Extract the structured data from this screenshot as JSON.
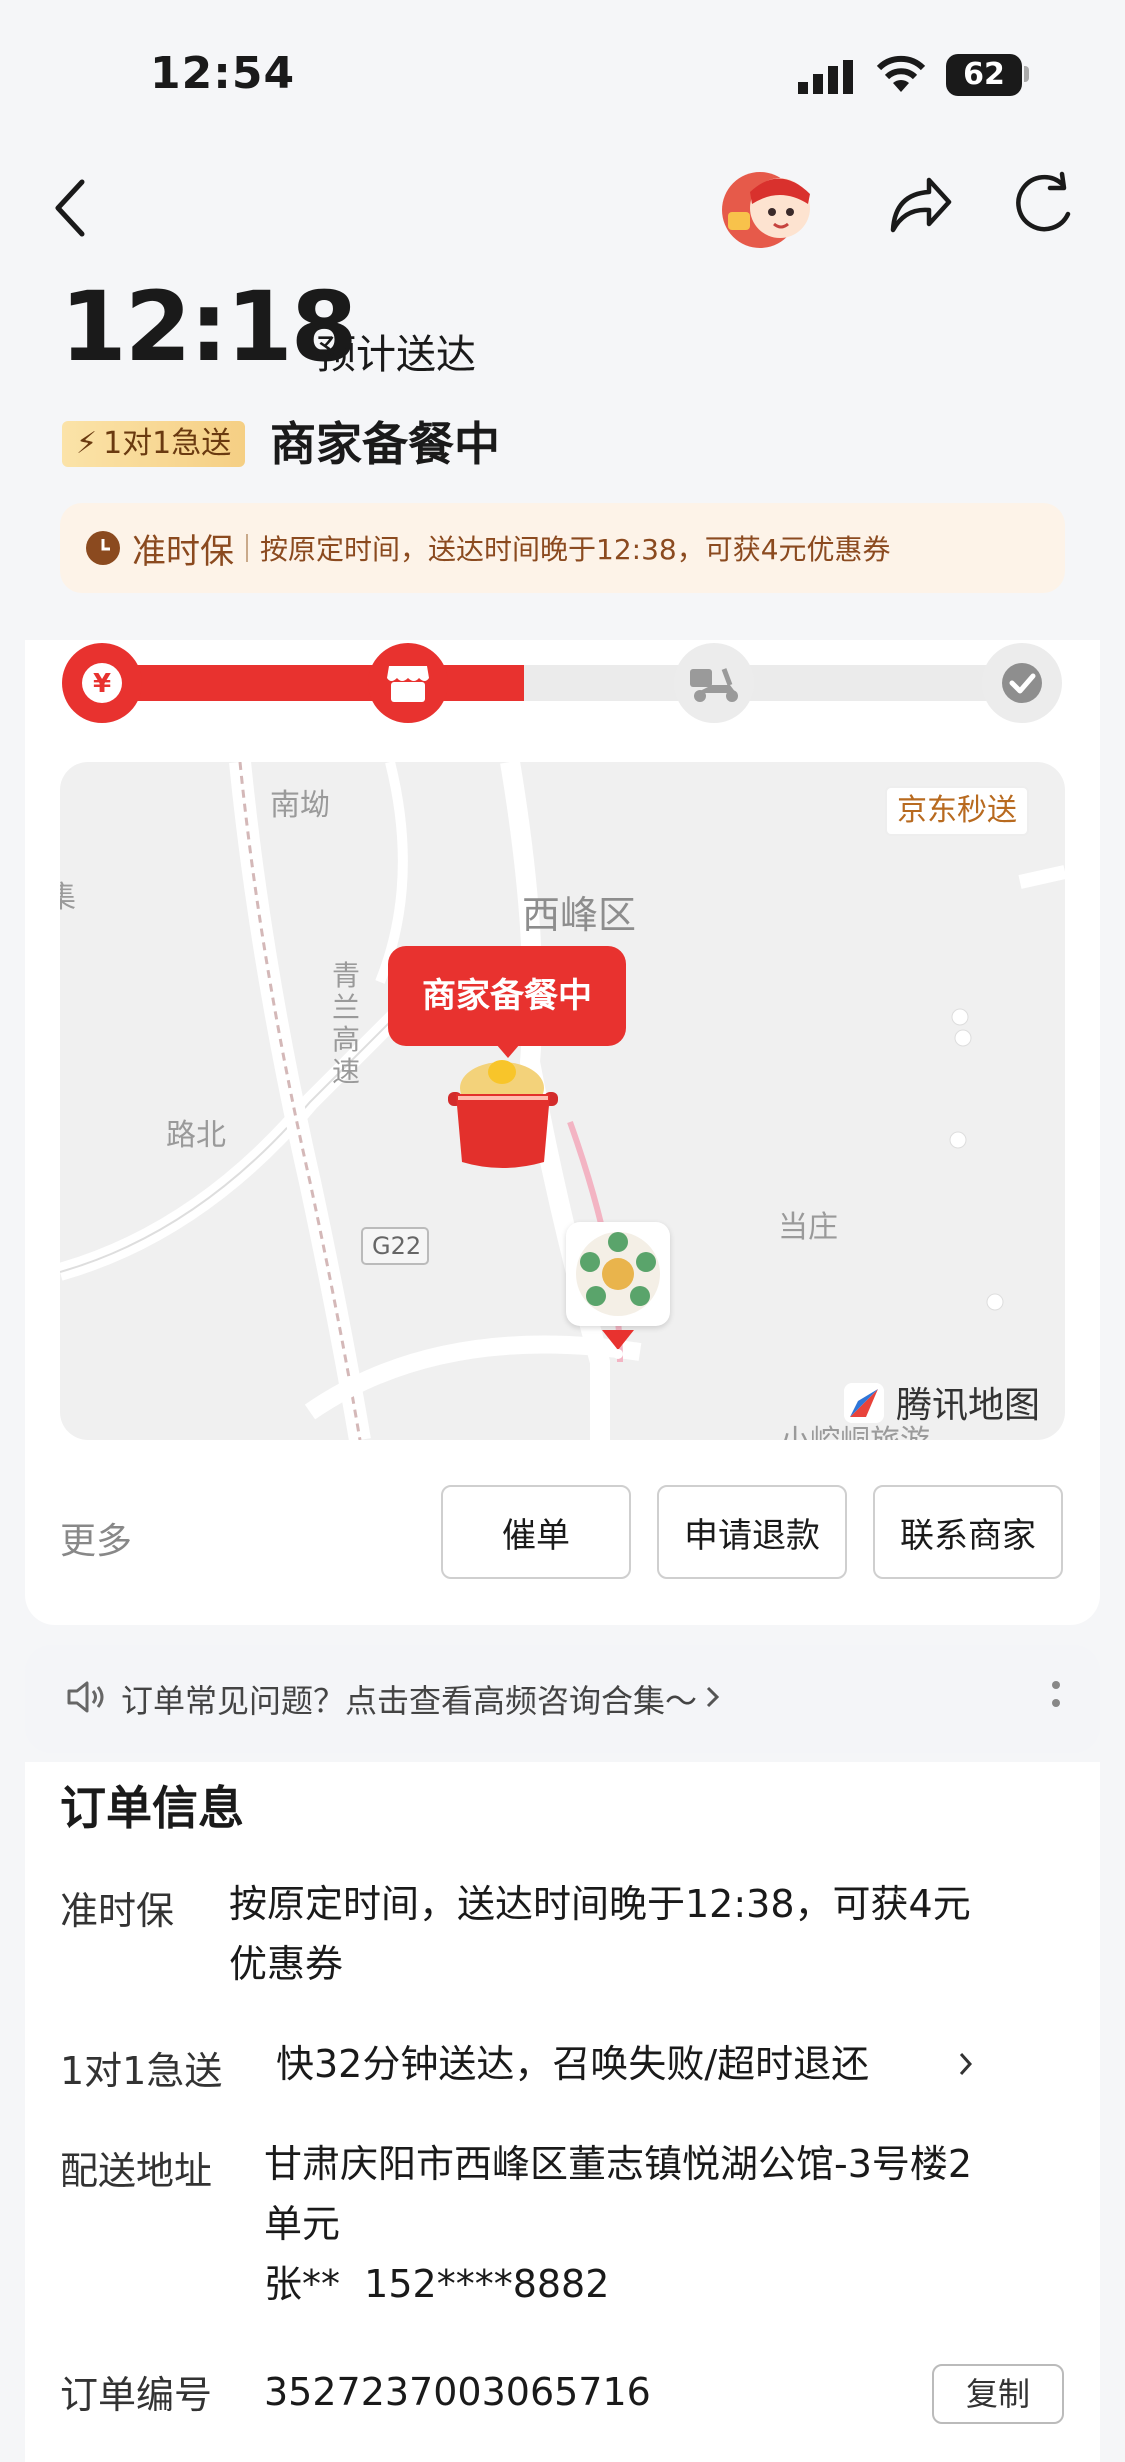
{
  "status_bar": {
    "time": "12:54",
    "battery": "62"
  },
  "header": {
    "eta_time": "12:18",
    "eta_label": "预计送达"
  },
  "express_badge": "1对1急送",
  "order_status": "商家备餐中",
  "ontime": {
    "title": "准时保",
    "desc": "按原定时间，送达时间晚于12:38，可获4元优惠券"
  },
  "progress": {
    "current_step": 2,
    "total_steps": 4,
    "steps": [
      "yen-icon",
      "store-icon",
      "scooter-icon",
      "check-icon"
    ],
    "accent": "#e8322f"
  },
  "map": {
    "provider": "京东秒送",
    "bubble": "商家备餐中",
    "labels": {
      "nanao": "南坳",
      "xifeng": "西峰区",
      "lubei": "路北",
      "dangzhuang": "当庄",
      "highway": "青兰高速",
      "road_code": "G22",
      "edge": "集",
      "bottom": "小崆峒旅游"
    },
    "attribution": "腾讯地图"
  },
  "actions": {
    "more": "更多",
    "urge": "催单",
    "refund": "申请退款",
    "contact": "联系商家"
  },
  "faq": "订单常见问题？点击查看高频咨询合集～",
  "order_info": {
    "title": "订单信息",
    "ontime_label": "准时保",
    "ontime_value_1": "按原定时间，送达时间晚于12:38，可获4元",
    "ontime_value_2": "优惠券",
    "express_label": "1对1急送",
    "express_value": "快32分钟送达，召唤失败/超时退还",
    "address_label": "配送地址",
    "address_1": "甘肃庆阳市西峰区董志镇悦湖公馆-3号楼2",
    "address_2": "单元",
    "contact": "张**  152****8882",
    "order_no_label": "订单编号",
    "order_no": "3527237003065716",
    "copy": "复制"
  }
}
